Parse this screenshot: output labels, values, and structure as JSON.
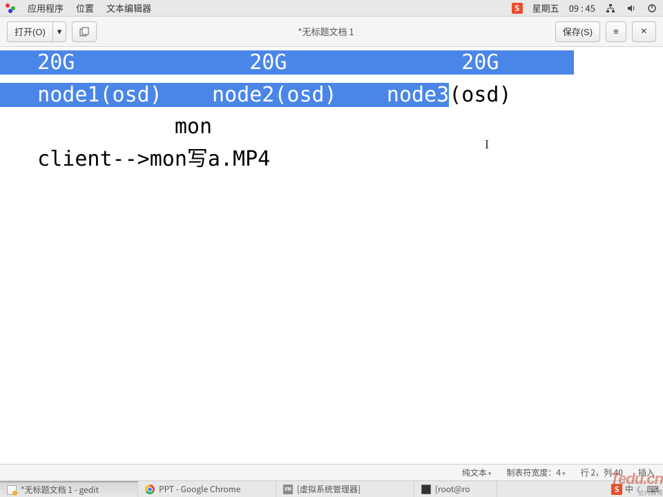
{
  "panel": {
    "menu_apps": "应用程序",
    "menu_places": "位置",
    "menu_editor": "文本编辑器",
    "day": "星期五",
    "time": "09 : 45"
  },
  "toolbar": {
    "open_label": "打开(O)",
    "save_label": "保存(S)",
    "title": "*无标题文档 1"
  },
  "content": {
    "line1_a": "   20G              20G              20G",
    "line1_pad_right": "      ",
    "line2_sel": "   node1(osd)    node2(osd)    node3",
    "line2_rest": "(osd)",
    "blank": "",
    "line_mon": "              mon",
    "line_client": "   client-->mon写a.MP4"
  },
  "status": {
    "lang": "纯文本",
    "tabwidth": "制表符宽度：4",
    "pos": "行 2，列 40",
    "mode": "插入"
  },
  "taskbar": {
    "t1": "*无标题文档 1 - gedit",
    "t2": "PPT - Google Chrome",
    "t3": "[虚拟系统管理器]",
    "t4": "[root@ro",
    "ime": "中"
  },
  "watermark": {
    "main": "Tedu.cn",
    "sub": "达内教育"
  }
}
